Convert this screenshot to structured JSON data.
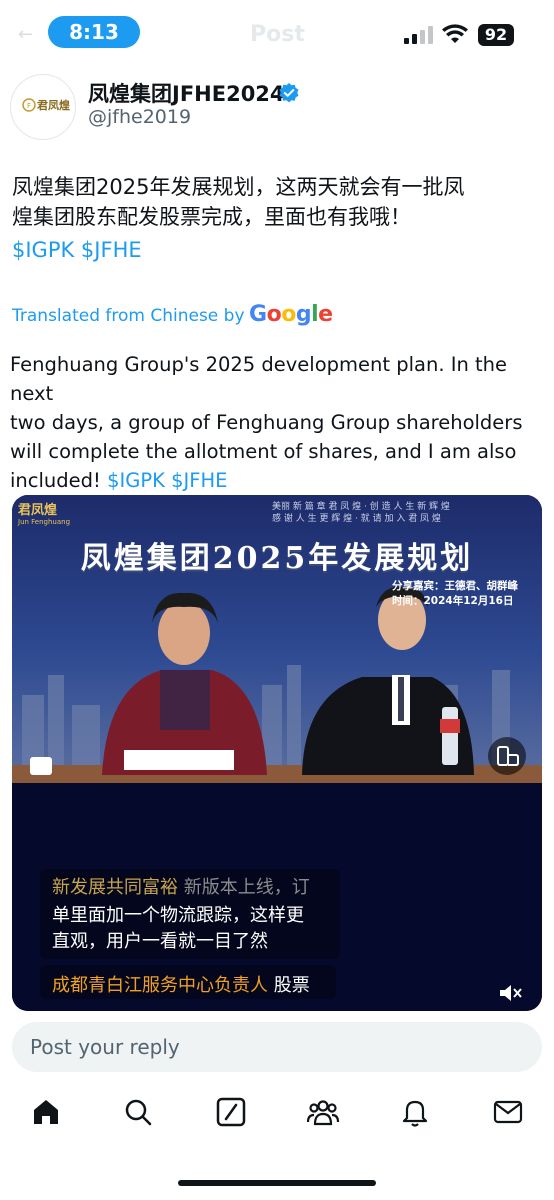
{
  "status_bar": {
    "time": "8:13",
    "battery": "92",
    "ghost_title": "Post"
  },
  "tweet": {
    "display_name": "凤煌集团JFHE2024",
    "handle": "@jfhe2019",
    "avatar_text": "君凤煌",
    "text_line1": "凤煌集团2025年发展规划，这两天就会有一批凤",
    "text_line2": "煌集团股东配发股票完成，里面也有我哦！",
    "cashtags": "$IGPK $JFHE",
    "translated_label": "Translated from Chinese by",
    "translated_brand": "Google",
    "translation_line1": "Fenghuang Group's 2025 development plan. In the next",
    "translation_line2": "two days, a group of Fenghuang Group shareholders",
    "translation_line3": "will complete the allotment of shares, and I am also",
    "translation_line4": "included!",
    "translation_cashtags": "$IGPK $JFHE"
  },
  "video": {
    "logo_text": "君凤煌",
    "logo_sub": "Jun Fenghuang",
    "ticker_line1": "美丽 新 篇 章 君 凤 煌 · 创 造 人 生 新 辉 煌",
    "ticker_line2": "感 谢 人 生 更 辉 煌 · 就 请 加 入 君 凤 煌",
    "title": "凤煌集团2025年发展规划",
    "guests_line1": "分享嘉宾：王德君、胡群峰",
    "guests_line2": "时间：2024年12月16日",
    "sub1_a": "新发展共同富裕",
    "sub1_b": "新版本上线，订",
    "sub2": "单里面加一个物流跟踪，这样更",
    "sub3": "直观，用户一看就一目了然",
    "sub4_a": "成都青白江服务中心负责人",
    "sub4_b": "股票"
  },
  "reply": {
    "placeholder": "Post your reply"
  },
  "tabs": [
    "home-icon",
    "search-icon",
    "grok-icon",
    "communities-icon",
    "notifications-icon",
    "messages-icon"
  ],
  "colors": {
    "accent": "#1d9bf0",
    "text": "#0f1419",
    "muted": "#536471"
  }
}
